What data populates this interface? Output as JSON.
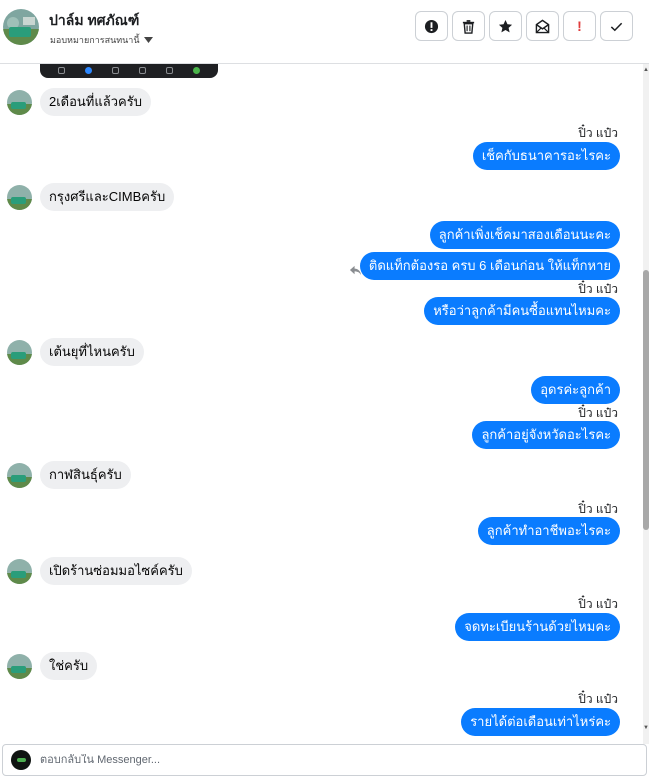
{
  "header": {
    "name": "ปาล์ม ทศภัณฑ์",
    "assign_label": "มอบหมายการสนทนานี้",
    "actions": [
      "report-spam-icon",
      "trash-icon",
      "star-icon",
      "mark-unread-icon",
      "follow-up-icon",
      "done-icon"
    ]
  },
  "messages": [
    {
      "dir": "in",
      "text": "2เดือนที่แล้วครับ"
    },
    {
      "dir": "out",
      "sender": "ปิ๋ว แป๋ว",
      "text": "เช็คกับธนาคารอะไรคะ"
    },
    {
      "dir": "in",
      "text": "กรุงศรีและCIMBครับ"
    },
    {
      "dir": "out",
      "text": "ลูกค้าเพิ่งเช็คมาสองเดือนนะคะ"
    },
    {
      "dir": "out",
      "text": "ติดแท็กต้องรอ ครบ 6 เดือนก่อน ให้แท็กหาย"
    },
    {
      "dir": "out",
      "sender": "ปิ๋ว แป๋ว",
      "text": "หรือว่าลูกค้ามีคนซื้อแทนไหมคะ"
    },
    {
      "dir": "in",
      "text": "เต้นยุที่ไหนครับ"
    },
    {
      "dir": "out",
      "text": "อุดรค่ะลูกค้า"
    },
    {
      "dir": "out",
      "sender": "ปิ๋ว แป๋ว",
      "text": "ลูกค้าอยู่จังหวัดอะไรคะ"
    },
    {
      "dir": "in",
      "text": "กาฬสินธุ์ครับ"
    },
    {
      "dir": "out",
      "sender": "ปิ๋ว แป๋ว",
      "text": "ลูกค้าทำอาชีพอะไรคะ"
    },
    {
      "dir": "in",
      "text": "เปิดร้านซ่อมมอไซค์ครับ"
    },
    {
      "dir": "out",
      "sender": "ปิ๋ว แป๋ว",
      "text": "จดทะเบียนร้านด้วยไหมคะ"
    },
    {
      "dir": "in",
      "text": "ใช่ครับ"
    },
    {
      "dir": "out",
      "sender": "ปิ๋ว แป๋ว",
      "text": "รายได้ต่อเดือนเท่าไหร่คะ"
    }
  ],
  "reply": {
    "placeholder": "ตอบกลับใน Messenger..."
  }
}
